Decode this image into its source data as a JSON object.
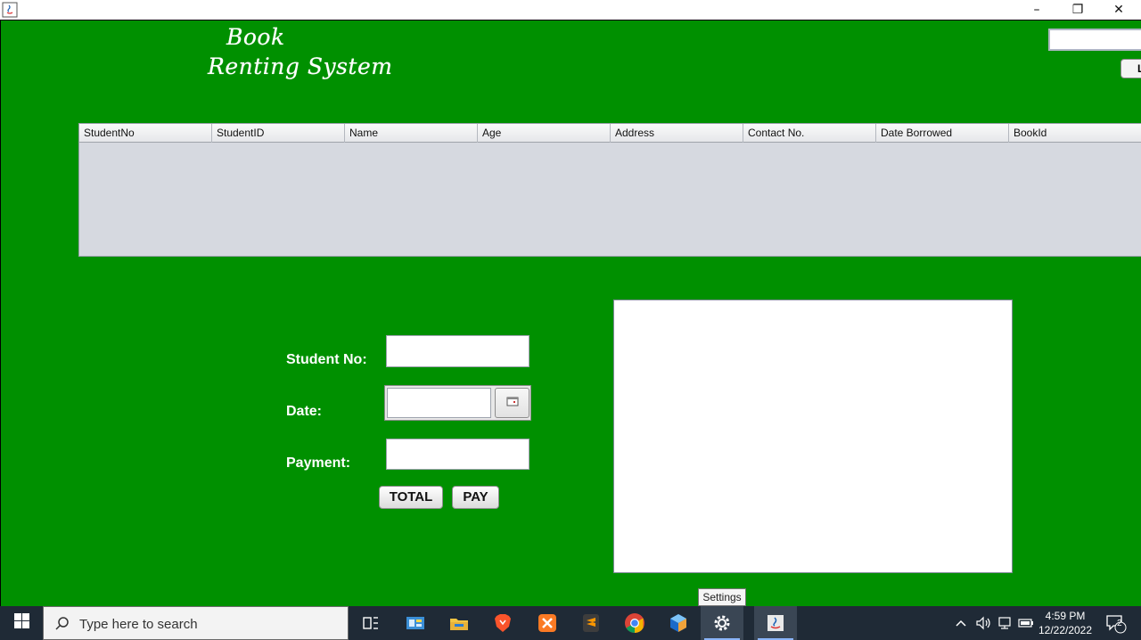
{
  "window": {
    "minimize_glyph": "–",
    "maximize_glyph": "❐",
    "close_glyph": "✕",
    "app_icon": "java-icon"
  },
  "header": {
    "title_line1": "Book",
    "title_line2": "Renting System",
    "top_button_label": "L"
  },
  "table": {
    "columns": [
      "StudentNo",
      "StudentID",
      "Name",
      "Age",
      "Address",
      "Contact No.",
      "Date Borrowed",
      "BookId"
    ],
    "rows": []
  },
  "form": {
    "student_no_label": "Student No:",
    "student_no_value": "",
    "date_label": "Date:",
    "date_value": "",
    "payment_label": "Payment:",
    "payment_value": "",
    "total_button": "TOTAL",
    "pay_button": "PAY"
  },
  "receipt_area": {
    "text": ""
  },
  "tooltip": {
    "text": "Settings"
  },
  "taskbar": {
    "search_placeholder": "Type here to search",
    "apps": [
      "task-view-icon",
      "control-panel-icon",
      "file-explorer-icon",
      "brave-icon",
      "xampp-icon",
      "sublime-text-icon",
      "chrome-icon",
      "netbeans-icon",
      "settings-icon",
      "java-icon"
    ],
    "time": "4:59 PM",
    "date": "12/22/2022",
    "notification_count": "2"
  },
  "colors": {
    "background_green": "#009000",
    "table_body": "#d6d9e0",
    "taskbar": "#1f2a36"
  }
}
